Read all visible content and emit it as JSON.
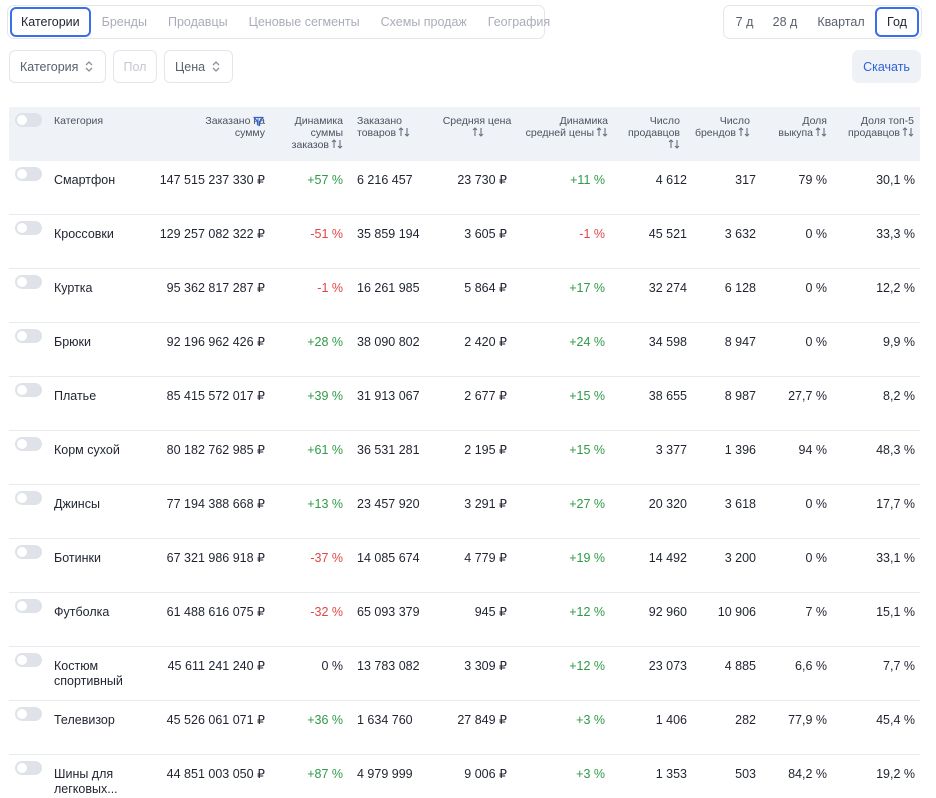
{
  "tabs": [
    {
      "label": "Категории",
      "active": true
    },
    {
      "label": "Бренды",
      "active": false
    },
    {
      "label": "Продавцы",
      "active": false
    },
    {
      "label": "Ценовые сегменты",
      "active": false
    },
    {
      "label": "Схемы продаж",
      "active": false
    },
    {
      "label": "География",
      "active": false
    }
  ],
  "periods": [
    {
      "label": "7 д",
      "active": false
    },
    {
      "label": "28 д",
      "active": false
    },
    {
      "label": "Квартал",
      "active": false
    },
    {
      "label": "Год",
      "active": true
    }
  ],
  "filters": {
    "category": "Категория",
    "gender": "Пол",
    "price": "Цена"
  },
  "download_label": "Скачать",
  "columns": {
    "category": "Категория",
    "ordered_sum": "Заказано на сумму",
    "sum_dynamics": "Динамика суммы заказов",
    "ordered_items": "Заказано товаров",
    "avg_price": "Средняя цена",
    "avg_price_dynamics": "Динамика средней цены",
    "sellers": "Число продавцов",
    "brands": "Число брендов",
    "buyout_share": "Доля выкупа",
    "top5_share": "Доля топ-5 продавцов"
  },
  "rows": [
    {
      "name": "Смартфон",
      "sum": "147 515 237 330 ₽",
      "sum_dyn": "+57 %",
      "sum_dyn_sign": "pos",
      "items": "6 216 457",
      "avg": "23 730 ₽",
      "avg_dyn": "+11 %",
      "avg_dyn_sign": "pos",
      "sellers": "4 612",
      "brands": "317",
      "buyout": "79 %",
      "top5": "30,1 %"
    },
    {
      "name": "Кроссовки",
      "sum": "129 257 082 322 ₽",
      "sum_dyn": "-51 %",
      "sum_dyn_sign": "neg",
      "items": "35 859 194",
      "avg": "3 605 ₽",
      "avg_dyn": "-1 %",
      "avg_dyn_sign": "neg",
      "sellers": "45 521",
      "brands": "3 632",
      "buyout": "0 %",
      "top5": "33,3 %"
    },
    {
      "name": "Куртка",
      "sum": "95 362 817 287 ₽",
      "sum_dyn": "-1 %",
      "sum_dyn_sign": "neg",
      "items": "16 261 985",
      "avg": "5 864 ₽",
      "avg_dyn": "+17 %",
      "avg_dyn_sign": "pos",
      "sellers": "32 274",
      "brands": "6 128",
      "buyout": "0 %",
      "top5": "12,2 %"
    },
    {
      "name": "Брюки",
      "sum": "92 196 962 426 ₽",
      "sum_dyn": "+28 %",
      "sum_dyn_sign": "pos",
      "items": "38 090 802",
      "avg": "2 420 ₽",
      "avg_dyn": "+24 %",
      "avg_dyn_sign": "pos",
      "sellers": "34 598",
      "brands": "8 947",
      "buyout": "0 %",
      "top5": "9,9 %"
    },
    {
      "name": "Платье",
      "sum": "85 415 572 017 ₽",
      "sum_dyn": "+39 %",
      "sum_dyn_sign": "pos",
      "items": "31 913 067",
      "avg": "2 677 ₽",
      "avg_dyn": "+15 %",
      "avg_dyn_sign": "pos",
      "sellers": "38 655",
      "brands": "8 987",
      "buyout": "27,7 %",
      "top5": "8,2 %"
    },
    {
      "name": "Корм сухой",
      "sum": "80 182 762 985 ₽",
      "sum_dyn": "+61 %",
      "sum_dyn_sign": "pos",
      "items": "36 531 281",
      "avg": "2 195 ₽",
      "avg_dyn": "+15 %",
      "avg_dyn_sign": "pos",
      "sellers": "3 377",
      "brands": "1 396",
      "buyout": "94 %",
      "top5": "48,3 %"
    },
    {
      "name": "Джинсы",
      "sum": "77 194 388 668 ₽",
      "sum_dyn": "+13 %",
      "sum_dyn_sign": "pos",
      "items": "23 457 920",
      "avg": "3 291 ₽",
      "avg_dyn": "+27 %",
      "avg_dyn_sign": "pos",
      "sellers": "20 320",
      "brands": "3 618",
      "buyout": "0 %",
      "top5": "17,7 %"
    },
    {
      "name": "Ботинки",
      "sum": "67 321 986 918 ₽",
      "sum_dyn": "-37 %",
      "sum_dyn_sign": "neg",
      "items": "14 085 674",
      "avg": "4 779 ₽",
      "avg_dyn": "+19 %",
      "avg_dyn_sign": "pos",
      "sellers": "14 492",
      "brands": "3 200",
      "buyout": "0 %",
      "top5": "33,1 %"
    },
    {
      "name": "Футболка",
      "sum": "61 488 616 075 ₽",
      "sum_dyn": "-32 %",
      "sum_dyn_sign": "neg",
      "items": "65 093 379",
      "avg": "945 ₽",
      "avg_dyn": "+12 %",
      "avg_dyn_sign": "pos",
      "sellers": "92 960",
      "brands": "10 906",
      "buyout": "7 %",
      "top5": "15,1 %"
    },
    {
      "name": "Костюм спортивный",
      "sum": "45 611 241 240 ₽",
      "sum_dyn": "0 %",
      "sum_dyn_sign": "zero",
      "items": "13 783 082",
      "avg": "3 309 ₽",
      "avg_dyn": "+12 %",
      "avg_dyn_sign": "pos",
      "sellers": "23 073",
      "brands": "4 885",
      "buyout": "6,6 %",
      "top5": "7,7 %"
    },
    {
      "name": "Телевизор",
      "sum": "45 526 061 071 ₽",
      "sum_dyn": "+36 %",
      "sum_dyn_sign": "pos",
      "items": "1 634 760",
      "avg": "27 849 ₽",
      "avg_dyn": "+3 %",
      "avg_dyn_sign": "pos",
      "sellers": "1 406",
      "brands": "282",
      "buyout": "77,9 %",
      "top5": "45,4 %"
    },
    {
      "name": "Шины для легковых...",
      "sum": "44 851 003 050 ₽",
      "sum_dyn": "+87 %",
      "sum_dyn_sign": "pos",
      "items": "4 979 999",
      "avg": "9 006 ₽",
      "avg_dyn": "+3 %",
      "avg_dyn_sign": "pos",
      "sellers": "1 353",
      "brands": "503",
      "buyout": "84,2 %",
      "top5": "19,2 %"
    }
  ]
}
